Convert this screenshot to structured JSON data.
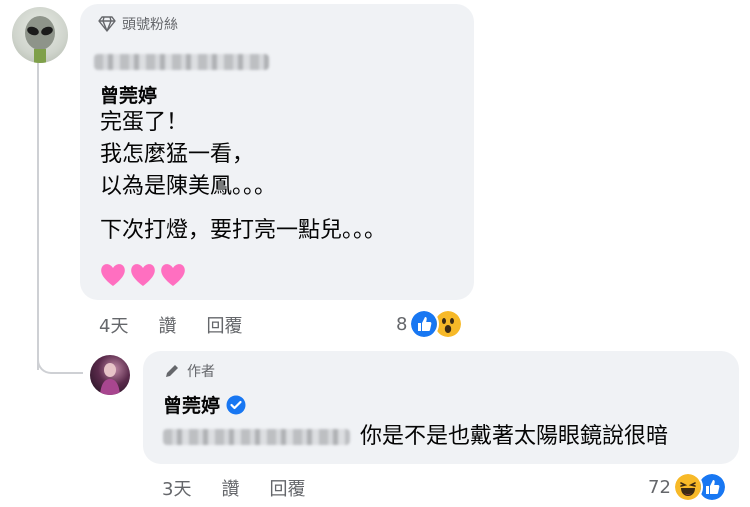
{
  "comment": {
    "badge_label": "頭號粉絲",
    "author": "曾莞婷",
    "lines": [
      "完蛋了！",
      "我怎麼猛一看，",
      "以為是陳美鳳。。。"
    ],
    "line_last": "下次打燈，要打亮一點兒。。。",
    "hearts": [
      "pink-heart-emoji",
      "pink-heart-emoji",
      "pink-heart-emoji"
    ],
    "time": "4天",
    "like_label": "讚",
    "reply_label": "回覆",
    "reaction_count": "8",
    "reactions": [
      "like-icon",
      "wow-icon"
    ]
  },
  "reply": {
    "badge_label": "作者",
    "author": "曾莞婷",
    "verified": true,
    "text": "你是不是也戴著太陽眼鏡說很暗",
    "time": "3天",
    "like_label": "讚",
    "reply_label": "回覆",
    "reaction_count": "72",
    "reactions": [
      "haha-icon",
      "like-icon"
    ]
  },
  "colors": {
    "bubble": "#f0f2f5",
    "secondary_text": "#65676b",
    "like_blue": "#1877f2",
    "heart_pink": "#ff6fc0",
    "emoji_yellow": "#f7b928"
  }
}
